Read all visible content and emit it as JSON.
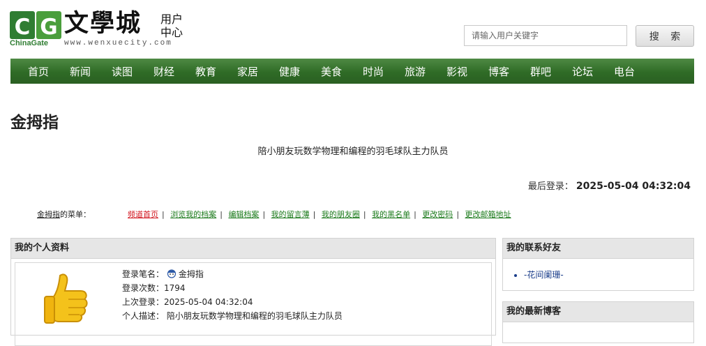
{
  "header": {
    "logo_cg_c": "C",
    "logo_cg_g": "G",
    "logo_chinagate": "ChinaGate",
    "logo_brand": "文學城",
    "logo_domain": "www.wenxuecity.com",
    "logo_sub_line1": "用户",
    "logo_sub_line2": "中心",
    "search_placeholder": "请输入用户关键字",
    "search_button": "搜 索"
  },
  "nav": [
    "首页",
    "新闻",
    "读图",
    "财经",
    "教育",
    "家居",
    "健康",
    "美食",
    "时尚",
    "旅游",
    "影视",
    "博客",
    "群吧",
    "论坛",
    "电台"
  ],
  "page": {
    "title": "金拇指",
    "motto": "陪小朋友玩数学物理和编程的羽毛球队主力队员",
    "last_login_label": "最后登录：",
    "last_login_value": "2025-05-04 04:32:04"
  },
  "menu": {
    "owner": "金拇指",
    "owner_suffix": "的菜单：",
    "links": [
      "频道首页",
      "浏览我的档案",
      "编辑档案",
      "我的留言薄",
      "我的朋友圈",
      "我的黑名单",
      "更改密码",
      "更改邮箱地址"
    ]
  },
  "profile": {
    "heading": "我的个人资料",
    "pen_name_label": "登录笔名：",
    "pen_name": "金拇指",
    "login_count_label": "登录次数：",
    "login_count": "1794",
    "last_login_label": "上次登录：",
    "last_login": "2025-05-04 04:32:04",
    "desc_label": "个人描述：",
    "desc": "陪小朋友玩数学物理和编程的羽毛球队主力队员"
  },
  "friends": {
    "heading": "我的联系好友",
    "items": [
      "-花间阑珊-"
    ]
  },
  "blogs": {
    "heading": "我的最新博客"
  },
  "colors": {
    "nav_green": "#2f6b26",
    "link_green": "#1a7a1a",
    "active_red": "#d2161f"
  }
}
